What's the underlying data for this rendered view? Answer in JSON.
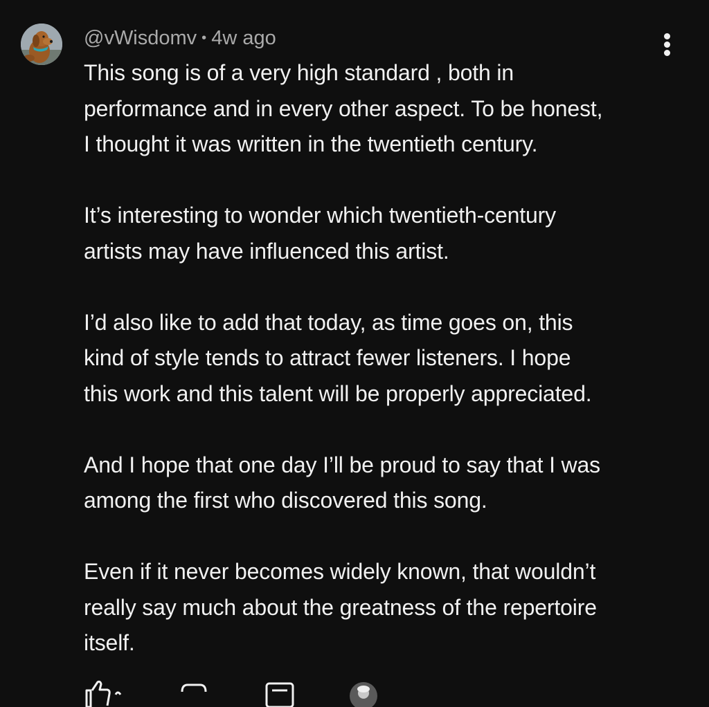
{
  "comment": {
    "author": "@vWisdomv",
    "separator": "•",
    "age": "4w ago",
    "paragraphs": [
      {
        "lines": [
          "This song is of a very high standard , both in",
          "performance and in every other aspect. To be honest,",
          "I thought it was written in the twentieth century."
        ]
      },
      {
        "lines": [
          "It’s interesting to wonder which twentieth-century",
          "artists may have influenced this artist."
        ]
      },
      {
        "lines": [
          "I’d also like to add that today, as time goes on, this",
          "kind of style tends to attract fewer listeners. I hope",
          "this work and this talent will be properly appreciated."
        ]
      },
      {
        "lines": [
          "And I hope that one day I’ll be proud to say that I was",
          "among the first who discovered this song."
        ]
      },
      {
        "lines": [
          "Even if it never becomes widely known, that wouldn’t",
          "really say much about the greatness of the repertoire",
          "itself."
        ]
      }
    ]
  },
  "icons": {
    "avatar": "dog-avatar",
    "menu": "more-vertical-icon",
    "like": "thumbs-up-icon",
    "dislike": "thumbs-down-icon",
    "reply": "reply-icon",
    "creator": "creator-avatar"
  },
  "colors": {
    "background": "#0f0f0f",
    "text": "#f1f1f1",
    "meta": "#aaaaaa"
  }
}
